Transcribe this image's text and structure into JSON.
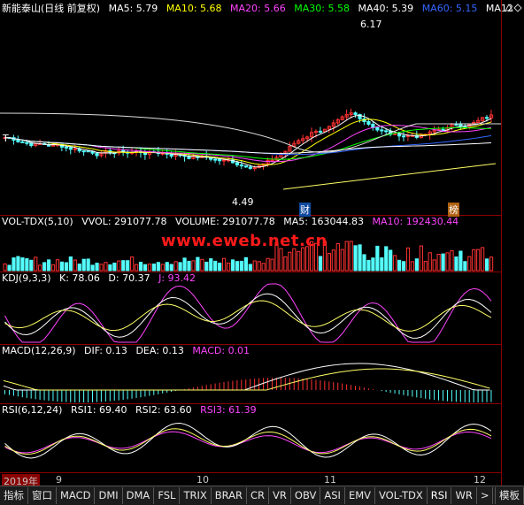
{
  "main": {
    "title": "新能泰山(日线 前复权)",
    "ma": [
      {
        "label": "MA5: 5.79",
        "color": "#ffffff"
      },
      {
        "label": "MA10: 5.68",
        "color": "#ffff00"
      },
      {
        "label": "MA20: 5.66",
        "color": "#ff44ff"
      },
      {
        "label": "MA30: 5.58",
        "color": "#00ff00"
      },
      {
        "label": "MA40: 5.39",
        "color": "#ffffff"
      },
      {
        "label": "MA60: 5.15",
        "color": "#3366ff"
      },
      {
        "label": "MA12",
        "color": "#ffffff"
      }
    ],
    "high_label": "6.17",
    "low_label": "4.49",
    "tag_cai": "财",
    "tag_bang": "榜",
    "left_marker": "T"
  },
  "volume": {
    "items": [
      {
        "label": "VOL-TDX(5,10)",
        "color": "#ffffff"
      },
      {
        "label": "VVOL: 291077.78",
        "color": "#ffffff"
      },
      {
        "label": "VOLUME: 291077.78",
        "color": "#ffffff"
      },
      {
        "label": "MA5: 163044.83",
        "color": "#ffffff"
      },
      {
        "label": "MA10: 192430.44",
        "color": "#ff44ff"
      }
    ]
  },
  "watermark": "www.eweb.net.cn",
  "kdj": {
    "items": [
      {
        "label": "KDJ(9,3,3)",
        "color": "#ffffff"
      },
      {
        "label": "K: 78.06",
        "color": "#ffffff"
      },
      {
        "label": "D: 70.37",
        "color": "#ffffff"
      },
      {
        "label": "J: 93.42",
        "color": "#ff44ff"
      }
    ]
  },
  "macd": {
    "items": [
      {
        "label": "MACD(12,26,9)",
        "color": "#ffffff"
      },
      {
        "label": "DIF: 0.13",
        "color": "#ffffff"
      },
      {
        "label": "DEA: 0.13",
        "color": "#ffffff"
      },
      {
        "label": "MACD: 0.01",
        "color": "#ff44ff"
      }
    ]
  },
  "rsi": {
    "items": [
      {
        "label": "RSI(6,12,24)",
        "color": "#ffffff"
      },
      {
        "label": "RSI1: 69.40",
        "color": "#ffffff"
      },
      {
        "label": "RSI2: 63.60",
        "color": "#ffffff"
      },
      {
        "label": "RSI3: 61.39",
        "color": "#ff44ff"
      }
    ]
  },
  "dates": [
    "2019年",
    "9",
    "10",
    "11",
    "12"
  ],
  "tabs": [
    "指标",
    "窗口",
    "MACD",
    "DMI",
    "DMA",
    "FSL",
    "TRIX",
    "BRAR",
    "CR",
    "VR",
    "OBV",
    "ASI",
    "EMV",
    "VOL-TDX",
    "RSI",
    "WR",
    ">",
    "模板"
  ],
  "active_tab": "RSI",
  "colors": {
    "up": "#ff3232",
    "down": "#54ffff",
    "grid": "#8a0000"
  }
}
